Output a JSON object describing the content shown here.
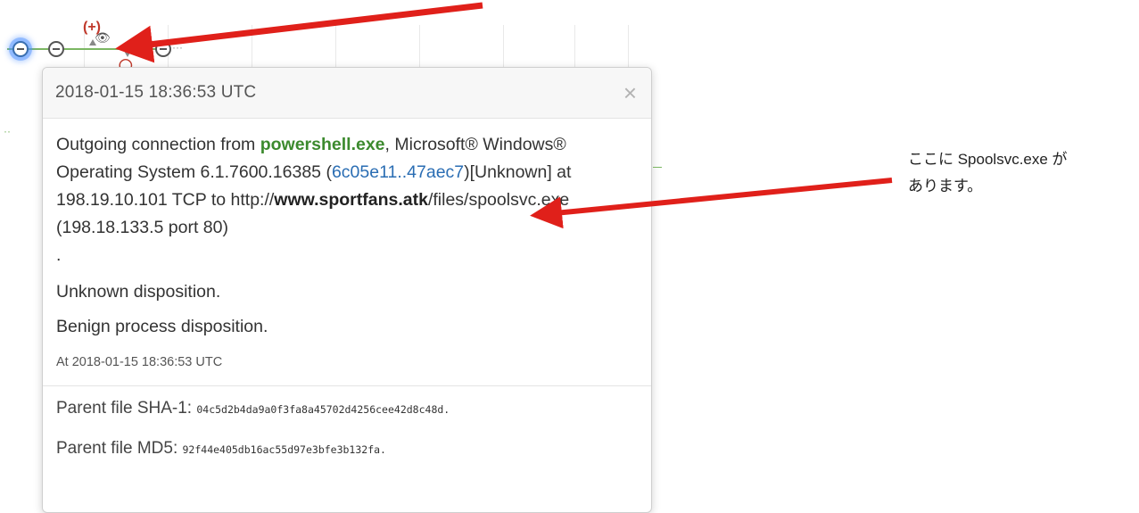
{
  "popover": {
    "title": "2018-01-15  18:36:53  UTC",
    "close_symbol": "×",
    "description": {
      "prefix": "Outgoing connection from ",
      "process_name": "powershell.exe",
      "os_text": ", Microsoft® Windows® Operating System 6.1.7600.16385 (",
      "hash_link": "6c05e11..47aec7",
      "middle": ")[Unknown] at 198.19.10.101 TCP to http://",
      "domain": "www.sportfans.atk",
      "suffix": "/files/spoolsvc.exe (198.18.133.5 port 80)",
      "period": "."
    },
    "disposition": "Unknown disposition.",
    "process_disposition": "Benign process disposition.",
    "at_label": "At ",
    "at_value": "2018-01-15  18:36:53  UTC",
    "parent_sha1_label": "Parent file SHA-1: ",
    "parent_sha1": "04c5d2b4da9a0f3fa8a45702d4256cee42d8c48d.",
    "parent_md5_label": "Parent file MD5: ",
    "parent_md5": "92f44e405db16ac55d97e3bfe3b132fa."
  },
  "annotation": {
    "line1": "ここに Spoolsvc.exe が",
    "line2": "あります。"
  },
  "colors": {
    "arrow": "#e0201a",
    "process_green": "#3c8a2e",
    "link_blue": "#2a6db3",
    "timeline_green": "#7bb662"
  },
  "icons": [
    "eye-icon",
    "close-icon",
    "timeline-node-icon",
    "plus-marker-icon"
  ]
}
